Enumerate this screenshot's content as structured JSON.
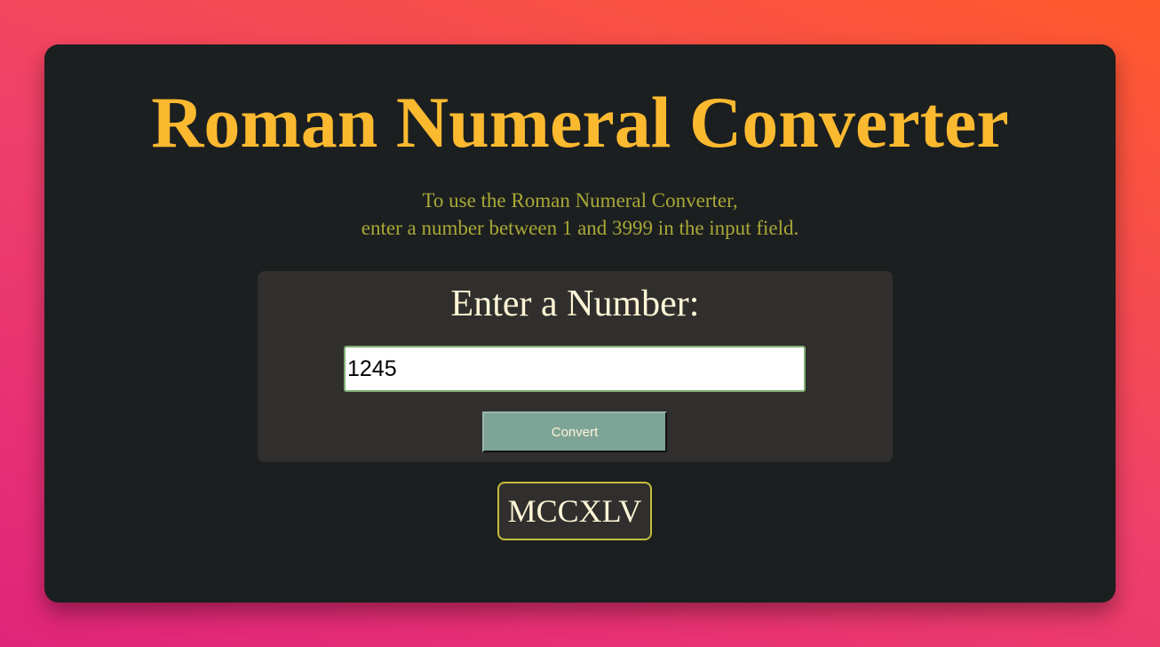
{
  "header": {
    "title": "Roman Numeral Converter",
    "instructions_line1": "To use the Roman Numeral Converter,",
    "instructions_line2": "enter a number between 1 and 3999 in the input field."
  },
  "form": {
    "label": "Enter a Number:",
    "input_value": "1245",
    "convert_label": "Convert"
  },
  "result": {
    "output": "MCCXLV"
  },
  "colors": {
    "title": "#fbb930",
    "instructions": "#a9a836",
    "card_bg": "#1c1f20",
    "form_bg": "#302f2d",
    "button_bg": "#7ea497",
    "output_border": "#c4bd3c"
  }
}
